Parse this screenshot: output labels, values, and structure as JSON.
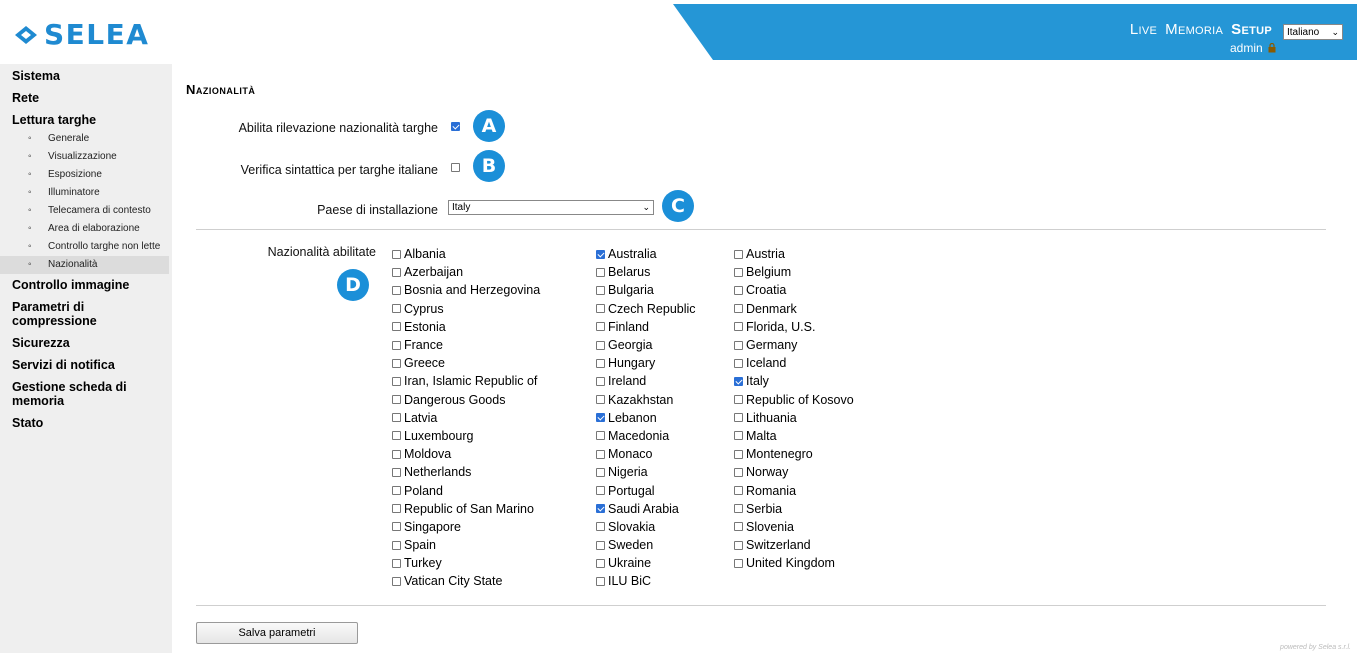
{
  "brand": {
    "name": "SELEA",
    "color": "#1f8ad1"
  },
  "topnav": {
    "items": [
      "Live",
      "Memoria",
      "Setup"
    ],
    "active": "Setup"
  },
  "language": {
    "selected": "Italiano"
  },
  "user": {
    "name": "admin"
  },
  "sidebar": {
    "sections": [
      {
        "label": "Sistema"
      },
      {
        "label": "Rete"
      },
      {
        "label": "Lettura targhe"
      },
      {
        "label": "Controllo immagine"
      },
      {
        "label": "Parametri di compressione"
      },
      {
        "label": "Sicurezza"
      },
      {
        "label": "Servizi di notifica"
      },
      {
        "label": "Gestione scheda di memoria"
      },
      {
        "label": "Stato"
      }
    ],
    "lettura_sub": [
      "Generale",
      "Visualizzazione",
      "Esposizione",
      "Illuminatore",
      "Telecamera di contesto",
      "Area di elaborazione",
      "Controllo targhe non lette",
      "Nazionalità"
    ],
    "active_sub": "Nazionalità"
  },
  "page": {
    "title": "Nazionalità",
    "enable_label": "Abilita rilevazione nazionalità targhe",
    "enable_checked": true,
    "syntax_label": "Verifica sintattica per targhe italiane",
    "syntax_checked": false,
    "country_label": "Paese di installazione",
    "country_value": "Italy",
    "nationalities_label": "Nazionalità abilitate",
    "markers": [
      "A",
      "B",
      "C",
      "D"
    ],
    "save_label": "Salva parametri",
    "powered": "powered by Selea s.r.l."
  },
  "nationalities": {
    "col1": [
      {
        "n": "Albania",
        "c": false
      },
      {
        "n": "Azerbaijan",
        "c": false
      },
      {
        "n": "Bosnia and Herzegovina",
        "c": false
      },
      {
        "n": "Cyprus",
        "c": false
      },
      {
        "n": "Estonia",
        "c": false
      },
      {
        "n": "France",
        "c": false
      },
      {
        "n": "Greece",
        "c": false
      },
      {
        "n": "Iran, Islamic Republic of",
        "c": false
      },
      {
        "n": "Dangerous Goods",
        "c": false
      },
      {
        "n": "Latvia",
        "c": false
      },
      {
        "n": "Luxembourg",
        "c": false
      },
      {
        "n": "Moldova",
        "c": false
      },
      {
        "n": "Netherlands",
        "c": false
      },
      {
        "n": "Poland",
        "c": false
      },
      {
        "n": "Republic of San Marino",
        "c": false
      },
      {
        "n": "Singapore",
        "c": false
      },
      {
        "n": "Spain",
        "c": false
      },
      {
        "n": "Turkey",
        "c": false
      },
      {
        "n": "Vatican City State",
        "c": false
      }
    ],
    "col2": [
      {
        "n": "Australia",
        "c": true
      },
      {
        "n": "Belarus",
        "c": false
      },
      {
        "n": "Bulgaria",
        "c": false
      },
      {
        "n": "Czech Republic",
        "c": false
      },
      {
        "n": "Finland",
        "c": false
      },
      {
        "n": "Georgia",
        "c": false
      },
      {
        "n": "Hungary",
        "c": false
      },
      {
        "n": "Ireland",
        "c": false
      },
      {
        "n": "Kazakhstan",
        "c": false
      },
      {
        "n": "Lebanon",
        "c": true
      },
      {
        "n": "Macedonia",
        "c": false
      },
      {
        "n": "Monaco",
        "c": false
      },
      {
        "n": "Nigeria",
        "c": false
      },
      {
        "n": "Portugal",
        "c": false
      },
      {
        "n": "Saudi Arabia",
        "c": true
      },
      {
        "n": "Slovakia",
        "c": false
      },
      {
        "n": "Sweden",
        "c": false
      },
      {
        "n": "Ukraine",
        "c": false
      },
      {
        "n": "ILU BiC",
        "c": false
      }
    ],
    "col3": [
      {
        "n": "Austria",
        "c": false
      },
      {
        "n": "Belgium",
        "c": false
      },
      {
        "n": "Croatia",
        "c": false
      },
      {
        "n": "Denmark",
        "c": false
      },
      {
        "n": "Florida, U.S.",
        "c": false
      },
      {
        "n": "Germany",
        "c": false
      },
      {
        "n": "Iceland",
        "c": false
      },
      {
        "n": "Italy",
        "c": true
      },
      {
        "n": "Republic of Kosovo",
        "c": false
      },
      {
        "n": "Lithuania",
        "c": false
      },
      {
        "n": "Malta",
        "c": false
      },
      {
        "n": "Montenegro",
        "c": false
      },
      {
        "n": "Norway",
        "c": false
      },
      {
        "n": "Romania",
        "c": false
      },
      {
        "n": "Serbia",
        "c": false
      },
      {
        "n": "Slovenia",
        "c": false
      },
      {
        "n": "Switzerland",
        "c": false
      },
      {
        "n": "United Kingdom",
        "c": false
      }
    ]
  }
}
